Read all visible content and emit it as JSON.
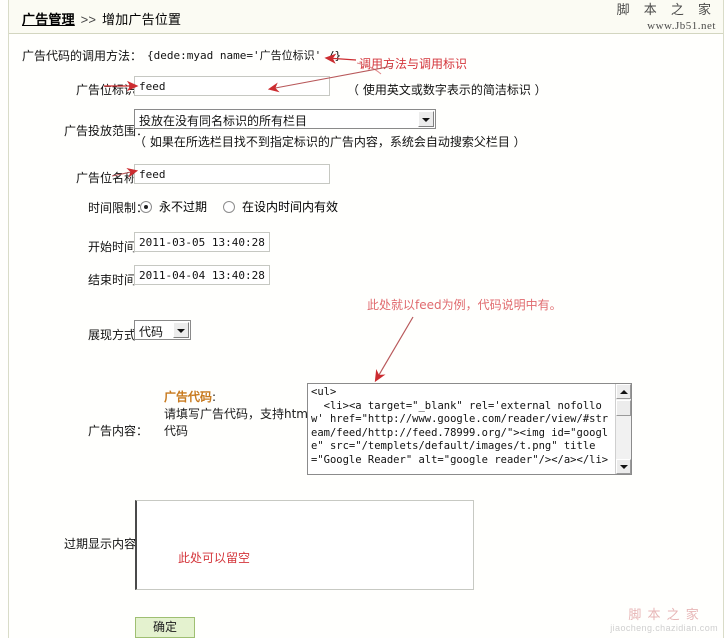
{
  "header": {
    "breadcrumb_link": "广告管理",
    "breadcrumb_sep": ">>",
    "breadcrumb_current": "增加广告位置"
  },
  "watermark": {
    "logo_cn": "脚 本 之 家",
    "logo_url": "www.Jb51.net",
    "bottom_cn": "脚 本 之 家",
    "bottom_url": "jiaocheng.chazidian.com"
  },
  "form": {
    "call_method": {
      "label": "广告代码的调用方法：",
      "value": "{dede:myad name='广告位标识' /}"
    },
    "ad_tag": {
      "label": "广告位标识：",
      "value": "feed",
      "hint": "（ 使用英文或数字表示的简洁标识 ）"
    },
    "ad_scope": {
      "label": "广告投放范围：",
      "selected": "投放在没有同名标识的所有栏目",
      "hint": "（ 如果在所选栏目找不到指定标识的广告内容，系统会自动搜索父栏目 ）"
    },
    "ad_name": {
      "label": "广告位名称：",
      "value": "feed"
    },
    "time_limit": {
      "label": "时间限制：",
      "options": [
        {
          "text": "永不过期",
          "checked": true
        },
        {
          "text": "在设内时间内有效",
          "checked": false
        }
      ]
    },
    "start_time": {
      "label": "开始时间：",
      "value": "2011-03-05 13:40:28"
    },
    "end_time": {
      "label": "结束时间：",
      "value": "2011-04-04 13:40:28"
    },
    "display_mode": {
      "label": "展现方式：",
      "selected": "代码"
    },
    "ad_content": {
      "label": "广告内容：",
      "hint_title": "广告代码",
      "hint_title_colon": ":",
      "hint_body": "请填写广告代码，支持html代码",
      "code": "<ul>\n  <li><a target=\"_blank\" rel='external nofollow' href=\"http://www.google.com/reader/view/#stream/feed/http://feed.78999.org/\"><img id=\"google\" src=\"/templets/default/images/t.png\" title=\"Google Reader\" alt=\"google reader\"/></a></li>"
    },
    "expired_content": {
      "label": "过期显示内容：",
      "placeholder_note": "此处可以留空"
    },
    "submit": {
      "label": "确定"
    }
  },
  "annotations": [
    {
      "id": "anno-call-method",
      "text": "调用方法与调用标识"
    },
    {
      "id": "anno-feed-example",
      "text": "此处就以feed为例，代码说明中有。"
    },
    {
      "id": "anno-can-be-empty",
      "text": "此处可以留空"
    }
  ],
  "colors": {
    "annotation_red": "#d4363c",
    "hint_orange": "#c87a1e",
    "submit_green_bg": "#e4f2cf",
    "submit_green_border": "#9fbf72",
    "panel_border": "#d9dcc8"
  }
}
